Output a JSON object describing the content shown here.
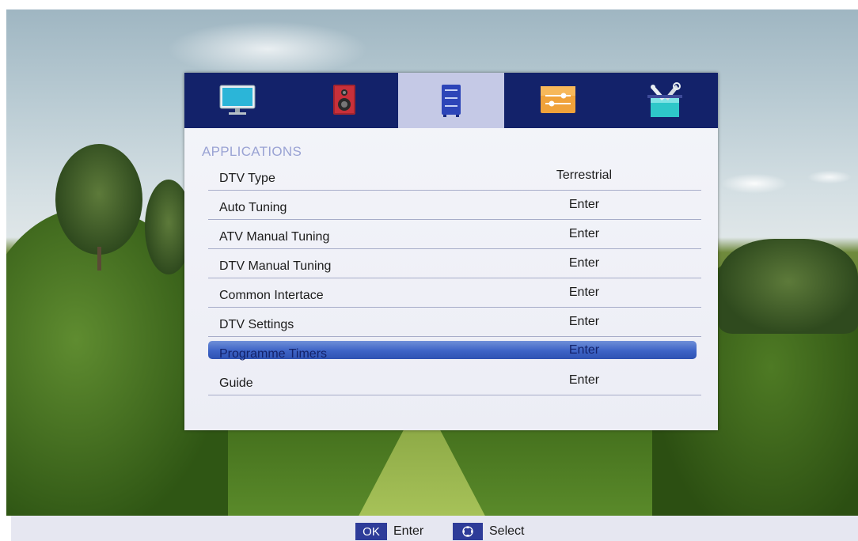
{
  "tabs": [
    {
      "icon": "tv-icon",
      "label": ""
    },
    {
      "icon": "speaker-icon",
      "label": ""
    },
    {
      "icon": "applications-icon",
      "label": "",
      "active": true
    },
    {
      "icon": "settings-sliders-icon",
      "label": ""
    },
    {
      "icon": "tools-icon",
      "label": ""
    }
  ],
  "section_title": "APPLICATIONS",
  "menu": [
    {
      "label": "DTV Type",
      "value": "Terrestrial"
    },
    {
      "label": "Auto Tuning",
      "value": "Enter"
    },
    {
      "label": "ATV Manual Tuning",
      "value": "Enter"
    },
    {
      "label": "DTV Manual Tuning",
      "value": "Enter"
    },
    {
      "label": "Common Intertace",
      "value": "Enter"
    },
    {
      "label": "DTV Settings",
      "value": "Enter"
    },
    {
      "label": "Programme Timers",
      "value": "Enter",
      "selected": true
    },
    {
      "label": "Guide",
      "value": "Enter"
    }
  ],
  "hints": {
    "ok_key": "OK",
    "ok_label": "Enter",
    "nav_key": "arrows",
    "nav_label": "Select"
  },
  "colors": {
    "tabbar": "#13226a",
    "active_tab": "#c5c9e6",
    "highlight": "#3d63c6",
    "section_title": "#9aa3d4"
  }
}
